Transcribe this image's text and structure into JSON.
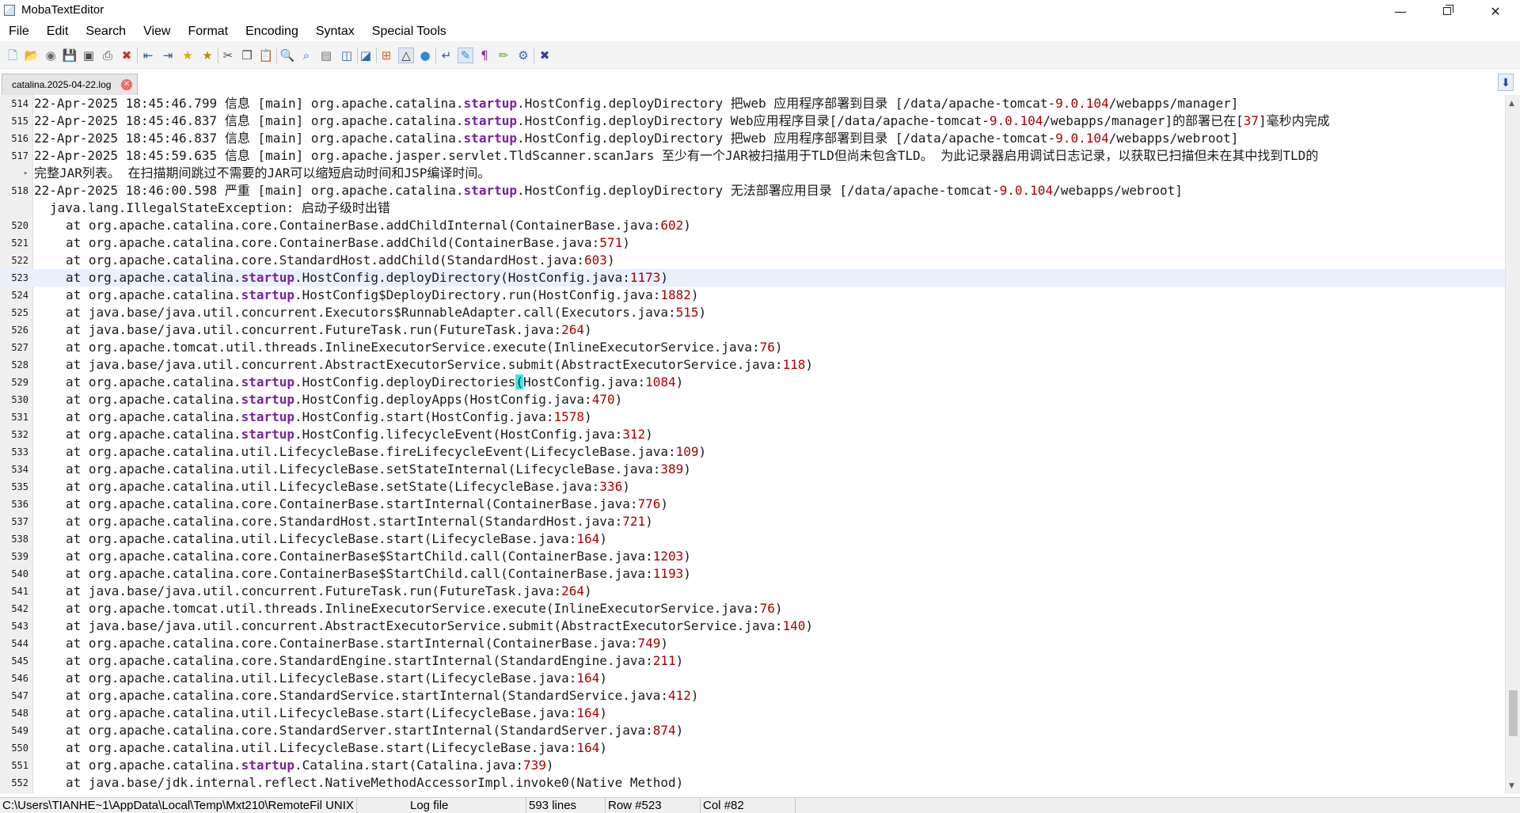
{
  "window": {
    "title": "MobaTextEditor",
    "minimize_glyph": "—",
    "close_glyph": "✕"
  },
  "menu": [
    "File",
    "Edit",
    "Search",
    "View",
    "Format",
    "Encoding",
    "Syntax",
    "Special Tools"
  ],
  "toolbar": {
    "buttons": [
      {
        "name": "new-file-icon",
        "glyph": "🗋",
        "color": "#5b8fd6"
      },
      {
        "name": "open-folder-icon",
        "glyph": "📂",
        "color": "#e3a21a"
      },
      {
        "name": "reload-icon",
        "glyph": "◉",
        "color": "#6d6d6d"
      },
      {
        "name": "save-icon",
        "glyph": "💾",
        "color": "#4a4a4a"
      },
      {
        "name": "save-all-icon",
        "glyph": "▣",
        "color": "#4a4a4a"
      },
      {
        "name": "print-icon",
        "glyph": "⎙",
        "color": "#4a4a4a"
      },
      {
        "name": "close-file-icon",
        "glyph": "✖",
        "color": "#d22a2a"
      },
      {
        "name": "unindent-icon",
        "glyph": "⇤",
        "color": "#3a5a8a"
      },
      {
        "name": "indent-icon",
        "glyph": "⇥",
        "color": "#3a5a8a"
      },
      {
        "name": "bookmark-icon",
        "glyph": "★",
        "color": "#e6a800"
      },
      {
        "name": "next-bookmark-icon",
        "glyph": "★",
        "color": "#c08a00"
      },
      {
        "name": "cut-icon",
        "glyph": "✂",
        "color": "#4a4a4a"
      },
      {
        "name": "copy-icon",
        "glyph": "❐",
        "color": "#4a4a4a"
      },
      {
        "name": "paste-icon",
        "glyph": "📋",
        "color": "#8a6a3a"
      },
      {
        "name": "find-icon",
        "glyph": "🔍",
        "color": "#2a6ab8"
      },
      {
        "name": "find-next-icon",
        "glyph": "⌕",
        "color": "#2a6ab8"
      },
      {
        "name": "replace-icon",
        "glyph": "▤",
        "color": "#6d6d6d"
      },
      {
        "name": "compare-icon",
        "glyph": "◫",
        "color": "#2a6ab8"
      },
      {
        "name": "diff-icon",
        "glyph": "◪",
        "color": "#2a6ab8"
      },
      {
        "name": "windows-format-icon",
        "glyph": "⊞",
        "color": "#e05a1a"
      },
      {
        "name": "unix-format-icon",
        "glyph": "△",
        "color": "#333333"
      },
      {
        "name": "mac-format-icon",
        "glyph": "●",
        "color": "#2a8ad8"
      },
      {
        "name": "word-wrap-icon",
        "glyph": "↵",
        "color": "#2a5aa8"
      },
      {
        "name": "syntax-icon",
        "glyph": "✎",
        "color": "#3a8ad8"
      },
      {
        "name": "paragraph-icon",
        "glyph": "¶",
        "color": "#8a2aa8"
      },
      {
        "name": "highlight-icon",
        "glyph": "✏",
        "color": "#6aa82a"
      },
      {
        "name": "settings-icon",
        "glyph": "⚙",
        "color": "#2a6ab8"
      },
      {
        "name": "exit-icon",
        "glyph": "✖",
        "color": "#3a3aa8"
      }
    ]
  },
  "tab": {
    "label": "catalina.2025-04-22.log",
    "close_glyph": "✕",
    "side_button_glyph": "⬇"
  },
  "editor": {
    "lines": [
      {
        "n": "514",
        "indent": 0,
        "text": "22-Apr-2025 18:45:46.799 信息 [main] org.apache.catalina.@@startup@@.HostConfig.deployDirectory 把web 应用程序部署到目录 [/data/apache-tomcat-9.0.104/webapps/manager]"
      },
      {
        "n": "515",
        "indent": 0,
        "text": "22-Apr-2025 18:45:46.837 信息 [main] org.apache.catalina.@@startup@@.HostConfig.deployDirectory Web应用程序目录[/data/apache-tomcat-9.0.104/webapps/manager]的部署已在[37]毫秒内完成"
      },
      {
        "n": "516",
        "indent": 0,
        "text": "22-Apr-2025 18:45:46.837 信息 [main] org.apache.catalina.@@startup@@.HostConfig.deployDirectory 把web 应用程序部署到目录 [/data/apache-tomcat-9.0.104/webapps/webroot]"
      },
      {
        "n": "517",
        "indent": 0,
        "text": "22-Apr-2025 18:45:59.635 信息 [main] org.apache.jasper.servlet.TldScanner.scanJars 至少有一个JAR被扫描用于TLD但尚未包含TLD。 为此记录器启用调试日志记录，以获取已扫描但未在其中找到TLD的"
      },
      {
        "n": "",
        "indent": 0,
        "wrap": true,
        "text": "完整JAR列表。 在扫描期间跳过不需要的JAR可以缩短启动时间和JSP编译时间。"
      },
      {
        "n": "518",
        "indent": 0,
        "text": "22-Apr-2025 18:46:00.598 严重 [main] org.apache.catalina.@@startup@@.HostConfig.deployDirectory 无法部署应用目录 [/data/apache-tomcat-9.0.104/webapps/webroot]"
      },
      {
        "n": "",
        "indent": 1,
        "text": "java.lang.IllegalStateException: 启动子级时出错"
      },
      {
        "n": "520",
        "indent": 2,
        "text": "at org.apache.catalina.core.ContainerBase.addChildInternal(ContainerBase.java:602)"
      },
      {
        "n": "521",
        "indent": 2,
        "text": "at org.apache.catalina.core.ContainerBase.addChild(ContainerBase.java:571)"
      },
      {
        "n": "522",
        "indent": 2,
        "text": "at org.apache.catalina.core.StandardHost.addChild(StandardHost.java:603)"
      },
      {
        "n": "523",
        "indent": 2,
        "current": true,
        "text": "at org.apache.catalina.@@startup@@.HostConfig.deployDirectory(HostConfig.java:1173)"
      },
      {
        "n": "524",
        "indent": 2,
        "text": "at org.apache.catalina.@@startup@@.HostConfig$DeployDirectory.run(HostConfig.java:1882)"
      },
      {
        "n": "525",
        "indent": 2,
        "text": "at java.base/java.util.concurrent.Executors$RunnableAdapter.call(Executors.java:515)"
      },
      {
        "n": "526",
        "indent": 2,
        "text": "at java.base/java.util.concurrent.FutureTask.run(FutureTask.java:264)"
      },
      {
        "n": "527",
        "indent": 2,
        "text": "at org.apache.tomcat.util.threads.InlineExecutorService.execute(InlineExecutorService.java:76)"
      },
      {
        "n": "528",
        "indent": 2,
        "text": "at java.base/java.util.concurrent.AbstractExecutorService.submit(AbstractExecutorService.java:118)"
      },
      {
        "n": "529",
        "indent": 2,
        "text": "at org.apache.catalina.@@startup@@.HostConfig.deployDirectories##(##HostConfig.java:1084)"
      },
      {
        "n": "530",
        "indent": 2,
        "text": "at org.apache.catalina.@@startup@@.HostConfig.deployApps(HostConfig.java:470)"
      },
      {
        "n": "531",
        "indent": 2,
        "text": "at org.apache.catalina.@@startup@@.HostConfig.start(HostConfig.java:1578)"
      },
      {
        "n": "532",
        "indent": 2,
        "text": "at org.apache.catalina.@@startup@@.HostConfig.lifecycleEvent(HostConfig.java:312)"
      },
      {
        "n": "533",
        "indent": 2,
        "text": "at org.apache.catalina.util.LifecycleBase.fireLifecycleEvent(LifecycleBase.java:109)"
      },
      {
        "n": "534",
        "indent": 2,
        "text": "at org.apache.catalina.util.LifecycleBase.setStateInternal(LifecycleBase.java:389)"
      },
      {
        "n": "535",
        "indent": 2,
        "text": "at org.apache.catalina.util.LifecycleBase.setState(LifecycleBase.java:336)"
      },
      {
        "n": "536",
        "indent": 2,
        "text": "at org.apache.catalina.core.ContainerBase.startInternal(ContainerBase.java:776)"
      },
      {
        "n": "537",
        "indent": 2,
        "text": "at org.apache.catalina.core.StandardHost.startInternal(StandardHost.java:721)"
      },
      {
        "n": "538",
        "indent": 2,
        "text": "at org.apache.catalina.util.LifecycleBase.start(LifecycleBase.java:164)"
      },
      {
        "n": "539",
        "indent": 2,
        "text": "at org.apache.catalina.core.ContainerBase$StartChild.call(ContainerBase.java:1203)"
      },
      {
        "n": "540",
        "indent": 2,
        "text": "at org.apache.catalina.core.ContainerBase$StartChild.call(ContainerBase.java:1193)"
      },
      {
        "n": "541",
        "indent": 2,
        "text": "at java.base/java.util.concurrent.FutureTask.run(FutureTask.java:264)"
      },
      {
        "n": "542",
        "indent": 2,
        "text": "at org.apache.tomcat.util.threads.InlineExecutorService.execute(InlineExecutorService.java:76)"
      },
      {
        "n": "543",
        "indent": 2,
        "text": "at java.base/java.util.concurrent.AbstractExecutorService.submit(AbstractExecutorService.java:140)"
      },
      {
        "n": "544",
        "indent": 2,
        "text": "at org.apache.catalina.core.ContainerBase.startInternal(ContainerBase.java:749)"
      },
      {
        "n": "545",
        "indent": 2,
        "text": "at org.apache.catalina.core.StandardEngine.startInternal(StandardEngine.java:211)"
      },
      {
        "n": "546",
        "indent": 2,
        "text": "at org.apache.catalina.util.LifecycleBase.start(LifecycleBase.java:164)"
      },
      {
        "n": "547",
        "indent": 2,
        "text": "at org.apache.catalina.core.StandardService.startInternal(StandardService.java:412)"
      },
      {
        "n": "548",
        "indent": 2,
        "text": "at org.apache.catalina.util.LifecycleBase.start(LifecycleBase.java:164)"
      },
      {
        "n": "549",
        "indent": 2,
        "text": "at org.apache.catalina.core.StandardServer.startInternal(StandardServer.java:874)"
      },
      {
        "n": "550",
        "indent": 2,
        "text": "at org.apache.catalina.util.LifecycleBase.start(LifecycleBase.java:164)"
      },
      {
        "n": "551",
        "indent": 2,
        "text": "at org.apache.catalina.@@startup@@.Catalina.start(Catalina.java:739)"
      },
      {
        "n": "552",
        "indent": 2,
        "text": "at java.base/jdk.internal.reflect.NativeMethodAccessorImpl.invoke0(Native Method)"
      }
    ]
  },
  "status": {
    "path": "C:\\Users\\TIANHE~1\\AppData\\Local\\Temp\\Mxt210\\RemoteFil",
    "line_ending": "UNIX",
    "file_type": "Log file",
    "line_count": "593 lines",
    "row": "Row #523",
    "col": "Col #82"
  },
  "colors": {
    "keyword": "#7b1fa2",
    "number": "#a80000",
    "current_line": "#e8f2fe",
    "bracket_highlight": "#3ce4ef"
  }
}
